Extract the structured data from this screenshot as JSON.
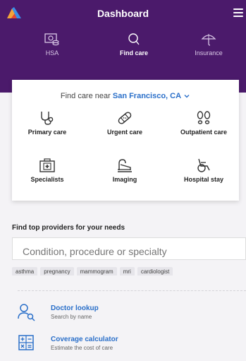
{
  "header": {
    "title": "Dashboard",
    "nav": [
      {
        "label": "HSA",
        "icon": "hsa-icon",
        "active": false
      },
      {
        "label": "Find care",
        "icon": "search-icon",
        "active": true
      },
      {
        "label": "Insurance",
        "icon": "umbrella-icon",
        "active": false
      }
    ]
  },
  "find_care": {
    "near_prefix": "Find care near",
    "location": "San Francisco, CA",
    "categories": [
      {
        "label": "Primary care",
        "icon": "stethoscope-icon"
      },
      {
        "label": "Urgent care",
        "icon": "bandage-icon"
      },
      {
        "label": "Outpatient care",
        "icon": "footprints-icon"
      },
      {
        "label": "Specialists",
        "icon": "first-aid-kit-icon"
      },
      {
        "label": "Imaging",
        "icon": "scanner-icon"
      },
      {
        "label": "Hospital stay",
        "icon": "wheelchair-icon"
      }
    ]
  },
  "providers": {
    "title": "Find top providers for your needs",
    "search_placeholder": "Condition, procedure or specialty",
    "tags": [
      "asthma",
      "pregnancy",
      "mammogram",
      "mri",
      "cardiologist"
    ]
  },
  "tools": [
    {
      "title": "Doctor lookup",
      "subtitle": "Search by name",
      "icon": "doctor-search-icon"
    },
    {
      "title": "Coverage calculator",
      "subtitle": "Estimate the cost of care",
      "icon": "calculator-icon"
    }
  ],
  "colors": {
    "header_bg": "#4b1a6b",
    "link": "#2a6fc9"
  }
}
